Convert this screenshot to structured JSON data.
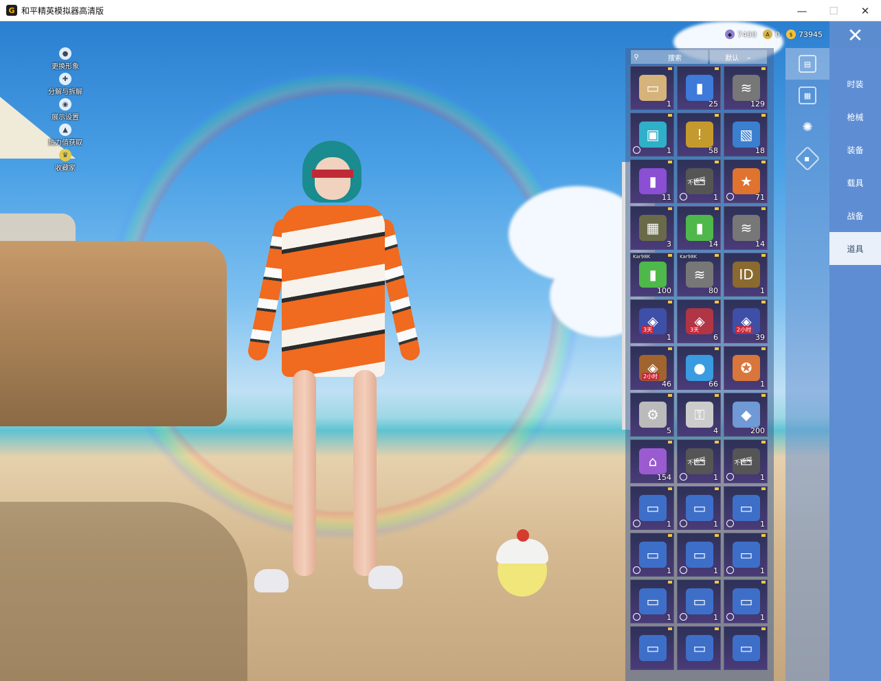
{
  "window": {
    "title": "和平精英模拟器高清版",
    "icon_letter": "G",
    "minimize": "—",
    "maximize": "☐",
    "close": "✕"
  },
  "left_menu": [
    {
      "label": "更换形象",
      "icon": "person-icon"
    },
    {
      "label": "分解与拆解",
      "icon": "puzzle-icon"
    },
    {
      "label": "展示设置",
      "icon": "eye-icon"
    },
    {
      "label": "热力值获取",
      "icon": "fire-icon"
    },
    {
      "label": "收藏家",
      "icon": "collector-icon"
    }
  ],
  "currency": [
    {
      "icon": "uc-coin-icon",
      "value": "7400",
      "color": "#8f7fd0"
    },
    {
      "icon": "honor-coin-icon",
      "value": "0",
      "color": "#d7b34b"
    },
    {
      "icon": "gold-coin-icon",
      "value": "73945",
      "color": "#f2c23a"
    }
  ],
  "inventory": {
    "search_label": "搜索",
    "sort_label": "默认",
    "items": [
      {
        "icon": "ticket-icon",
        "count": "1",
        "timed": false,
        "color": "#d6b37a"
      },
      {
        "icon": "spray-can-icon",
        "count": "25",
        "timed": false,
        "color": "#3d7ad9"
      },
      {
        "icon": "spring-icon",
        "count": "129",
        "timed": false,
        "color": "#777"
      },
      {
        "icon": "coupon-icon",
        "count": "1",
        "timed": true,
        "color": "#2fb0c8"
      },
      {
        "icon": "exclamation-card-icon",
        "count": "58",
        "timed": false,
        "color": "#c49a2f"
      },
      {
        "icon": "blue-card-icon",
        "count": "18",
        "timed": false,
        "color": "#3b7fcf"
      },
      {
        "icon": "spray-paint-icon",
        "count": "11",
        "timed": false,
        "color": "#8a4fd3"
      },
      {
        "icon": "ticket-icon",
        "count": "1",
        "timed": true,
        "label": "不稀罕",
        "color": "#555"
      },
      {
        "icon": "star-badge-icon",
        "count": "71",
        "timed": true,
        "color": "#e0732e"
      },
      {
        "icon": "toolbox-icon",
        "count": "3",
        "timed": false,
        "color": "#6a6a4a"
      },
      {
        "icon": "green-spray-icon",
        "count": "14",
        "timed": false,
        "color": "#4fb84a"
      },
      {
        "icon": "spring-icon",
        "count": "14",
        "timed": false,
        "color": "#777"
      },
      {
        "icon": "green-spray-icon",
        "count": "100",
        "timed": false,
        "weapon": "Kar98K",
        "color": "#4fb84a"
      },
      {
        "icon": "spring-icon",
        "count": "80",
        "timed": false,
        "weapon": "Kar98K",
        "color": "#777"
      },
      {
        "icon": "id-card-icon",
        "count": "1",
        "timed": false,
        "color": "#8a6a2e"
      },
      {
        "icon": "boost-card-icon",
        "count": "1",
        "timed": false,
        "badge": "3天",
        "color": "#3e4fa8"
      },
      {
        "icon": "boost-card-icon",
        "count": "6",
        "timed": false,
        "badge": "3天",
        "color": "#b03545"
      },
      {
        "icon": "boost-card-icon",
        "count": "39",
        "timed": false,
        "badge": "2小时",
        "color": "#3e4fa8"
      },
      {
        "icon": "boost-card-icon",
        "count": "46",
        "timed": false,
        "badge": "2小时",
        "color": "#a0642e"
      },
      {
        "icon": "orb-icon",
        "count": "66",
        "timed": false,
        "color": "#3a9be0"
      },
      {
        "icon": "medal-icon",
        "count": "1",
        "timed": false,
        "color": "#d9763b"
      },
      {
        "icon": "gear-ring-icon",
        "count": "5",
        "timed": false,
        "color": "#bbb"
      },
      {
        "icon": "key-icon",
        "count": "4",
        "timed": false,
        "color": "#ccc"
      },
      {
        "icon": "diamond-icon",
        "count": "200",
        "timed": false,
        "color": "#6f9ad6"
      },
      {
        "icon": "sprayer-icon",
        "count": "154",
        "timed": false,
        "color": "#9b5bd0"
      },
      {
        "icon": "ticket-icon",
        "count": "1",
        "timed": true,
        "label": "不稀罕",
        "color": "#555"
      },
      {
        "icon": "ticket-icon",
        "count": "1",
        "timed": true,
        "label": "不稀罕",
        "color": "#555"
      },
      {
        "icon": "voucher-icon",
        "count": "1",
        "timed": true,
        "color": "#3e6fc8"
      },
      {
        "icon": "voucher-icon",
        "count": "1",
        "timed": true,
        "color": "#3e6fc8"
      },
      {
        "icon": "voucher-icon",
        "count": "1",
        "timed": true,
        "color": "#3e6fc8"
      },
      {
        "icon": "voucher-icon",
        "count": "1",
        "timed": true,
        "color": "#3e6fc8"
      },
      {
        "icon": "voucher-icon",
        "count": "1",
        "timed": true,
        "color": "#3e6fc8"
      },
      {
        "icon": "voucher-icon",
        "count": "1",
        "timed": true,
        "color": "#3e6fc8"
      },
      {
        "icon": "voucher-icon",
        "count": "1",
        "timed": true,
        "color": "#3e6fc8"
      },
      {
        "icon": "voucher-icon",
        "count": "1",
        "timed": true,
        "color": "#3e6fc8"
      },
      {
        "icon": "voucher-icon",
        "count": "1",
        "timed": true,
        "color": "#3e6fc8"
      },
      {
        "icon": "voucher-icon",
        "count": "",
        "timed": false,
        "color": "#3e6fc8"
      },
      {
        "icon": "voucher-icon",
        "count": "",
        "timed": false,
        "color": "#3e6fc8"
      },
      {
        "icon": "voucher-icon",
        "count": "",
        "timed": false,
        "color": "#3e6fc8"
      }
    ]
  },
  "side_tabs": [
    {
      "icon": "card-icon",
      "active": true
    },
    {
      "icon": "calendar-icon",
      "active": false
    },
    {
      "icon": "sparkle-icon",
      "active": false
    },
    {
      "icon": "diamond-tag-icon",
      "active": false
    }
  ],
  "categories": [
    {
      "label": "时装",
      "active": false
    },
    {
      "label": "枪械",
      "active": false
    },
    {
      "label": "装备",
      "active": false
    },
    {
      "label": "载具",
      "active": false
    },
    {
      "label": "战备",
      "active": false
    },
    {
      "label": "道具",
      "active": true
    }
  ],
  "close_icon": "✕"
}
